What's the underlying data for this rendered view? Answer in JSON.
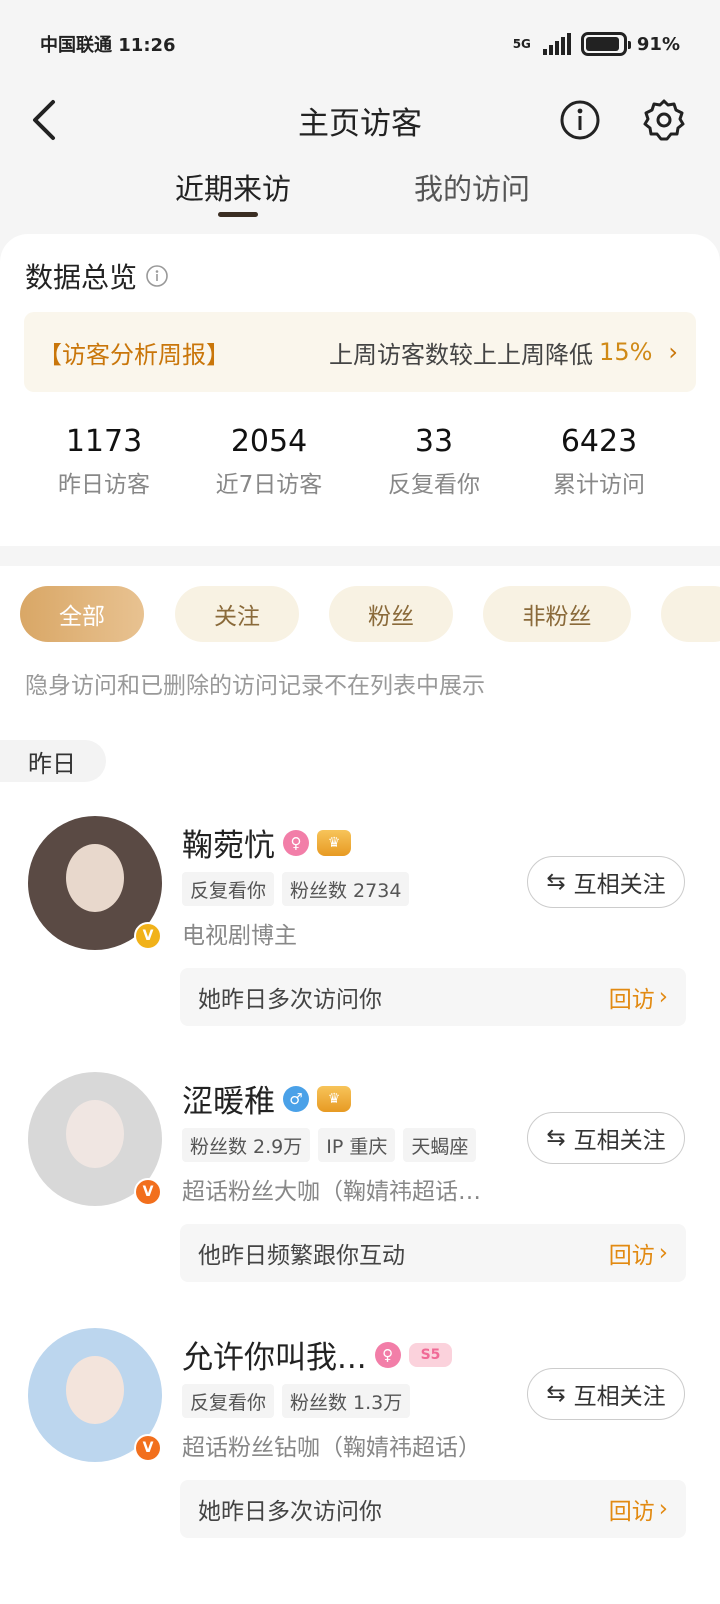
{
  "status_bar": {
    "carrier_time": "中国联通 11:26",
    "network": "5G",
    "battery": "91%",
    "battery_level": 0.91
  },
  "header": {
    "title": "主页访客",
    "back_icon": "chevron-left-icon",
    "info_icon": "info-icon",
    "settings_icon": "gear-icon"
  },
  "tabs": [
    {
      "label": "近期来访",
      "active": true
    },
    {
      "label": "我的访问",
      "active": false
    }
  ],
  "summary": {
    "title": "数据总览",
    "report": {
      "tag": "【访客分析周报】",
      "text": "上周访客数较上上周降低",
      "percent": "15%"
    },
    "stats": [
      {
        "value": "1173",
        "label": "昨日访客"
      },
      {
        "value": "2054",
        "label": "近7日访客"
      },
      {
        "value": "33",
        "label": "反复看你"
      },
      {
        "value": "6423",
        "label": "累计访问"
      }
    ]
  },
  "filters": [
    {
      "label": "全部",
      "active": true
    },
    {
      "label": "关注",
      "active": false
    },
    {
      "label": "粉丝",
      "active": false
    },
    {
      "label": "非粉丝",
      "active": false
    }
  ],
  "notice": "隐身访问和已删除的访问记录不在列表中展示",
  "date_group": "昨日",
  "visitors": [
    {
      "name": "鞠菀忼",
      "gender": "♀",
      "crown": "♛",
      "tags": [
        "反复看你",
        "粉丝数 2734"
      ],
      "desc": "电视剧博主",
      "follow_label": "互相关注",
      "follow_icon": "⇆",
      "visit_text": "她昨日多次访问你",
      "revisit_label": "回访",
      "verify": "V",
      "verify_color": "#f1b21a",
      "avatar_color": "#5a4a44"
    },
    {
      "name": "涩暖稚",
      "gender": "♂",
      "crown": "♛",
      "tags": [
        "粉丝数 2.9万",
        "IP 重庆",
        "天蝎座"
      ],
      "desc": "超话粉丝大咖（鞠婧祎超话…",
      "follow_label": "互相关注",
      "follow_icon": "⇆",
      "visit_text": "他昨日频繁跟你互动",
      "revisit_label": "回访",
      "verify": "V",
      "verify_color": "#f26f1d",
      "avatar_color": "#d8d8d8"
    },
    {
      "name": "允许你叫我...",
      "gender": "♀",
      "level": "S5",
      "tags": [
        "反复看你",
        "粉丝数 1.3万"
      ],
      "desc": "超话粉丝钻咖（鞠婧祎超话）",
      "follow_label": "互相关注",
      "follow_icon": "⇆",
      "visit_text": "她昨日多次访问你",
      "revisit_label": "回访",
      "verify": "V",
      "verify_color": "#f26f1d",
      "avatar_color": "#bcd6ee"
    }
  ]
}
